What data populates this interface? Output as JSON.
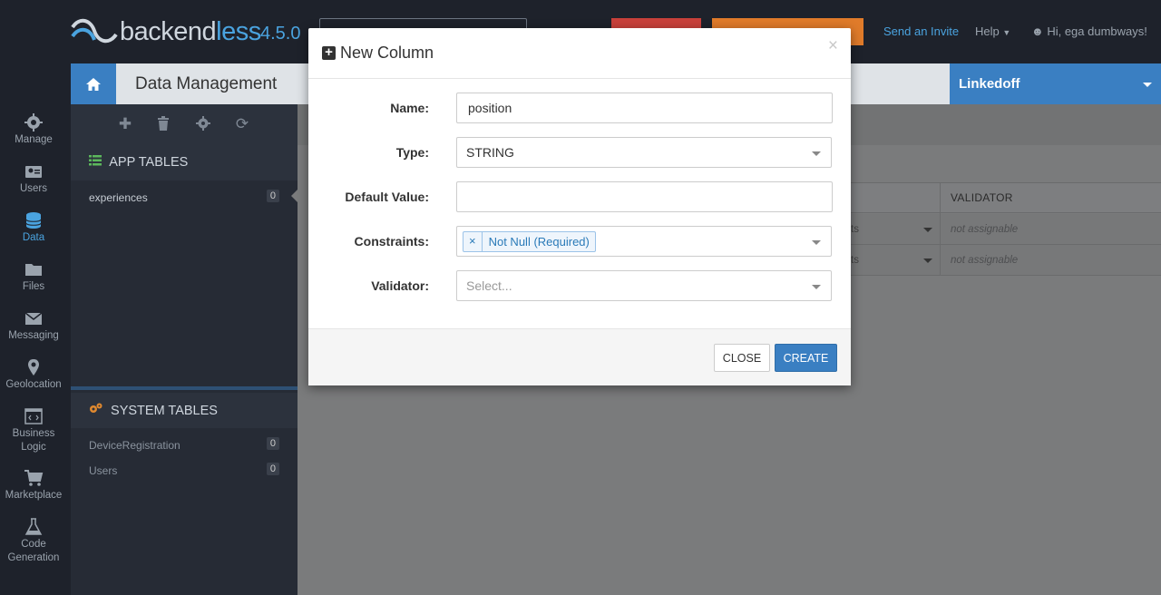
{
  "topbar": {
    "brand_main": "backend",
    "brand_accent": "less",
    "version": "4.5.0",
    "send_invite": "Send an Invite",
    "help": "Help",
    "user_greeting": "Hi, ega dumbways!"
  },
  "header": {
    "section_title": "Data Management",
    "app_name": "Linkedoff"
  },
  "leftnav": {
    "items": [
      {
        "label": "Manage",
        "icon": "gear-icon"
      },
      {
        "label": "Users",
        "icon": "users-icon"
      },
      {
        "label": "Data",
        "icon": "database-icon",
        "active": true
      },
      {
        "label": "Files",
        "icon": "folder-icon"
      },
      {
        "label": "Messaging",
        "icon": "envelope-icon"
      },
      {
        "label": "Geolocation",
        "icon": "map-marker-icon"
      },
      {
        "label": "Business",
        "label2": "Logic",
        "icon": "code-icon"
      },
      {
        "label": "Marketplace",
        "icon": "cart-icon"
      },
      {
        "label": "Code",
        "label2": "Generation",
        "icon": "flask-icon"
      }
    ]
  },
  "tables": {
    "app_header": "APP TABLES",
    "app_tables": [
      {
        "name": "experiences",
        "count": "0"
      }
    ],
    "system_header": "SYSTEM TABLES",
    "system_tables": [
      {
        "name": "DeviceRegistration",
        "count": "0"
      },
      {
        "name": "Users",
        "count": "0"
      }
    ]
  },
  "grid": {
    "validator_header": "VALIDATOR",
    "rows": [
      {
        "cut": "ts",
        "validator": "not assignable"
      },
      {
        "cut": "ts",
        "validator": "not assignable"
      }
    ]
  },
  "modal": {
    "title": "New Column",
    "name_label": "Name:",
    "name_value": "position",
    "type_label": "Type:",
    "type_value": "STRING",
    "default_label": "Default Value:",
    "default_value": "",
    "constraints_label": "Constraints:",
    "constraint_tag": "Not Null (Required)",
    "validator_label": "Validator:",
    "validator_placeholder": "Select...",
    "close_label": "CLOSE",
    "create_label": "CREATE"
  },
  "colors": {
    "accent": "#3a7fc2",
    "link": "#4aa3df",
    "sidebar_bg": "#1e222b",
    "panel_bg": "#262b35"
  }
}
